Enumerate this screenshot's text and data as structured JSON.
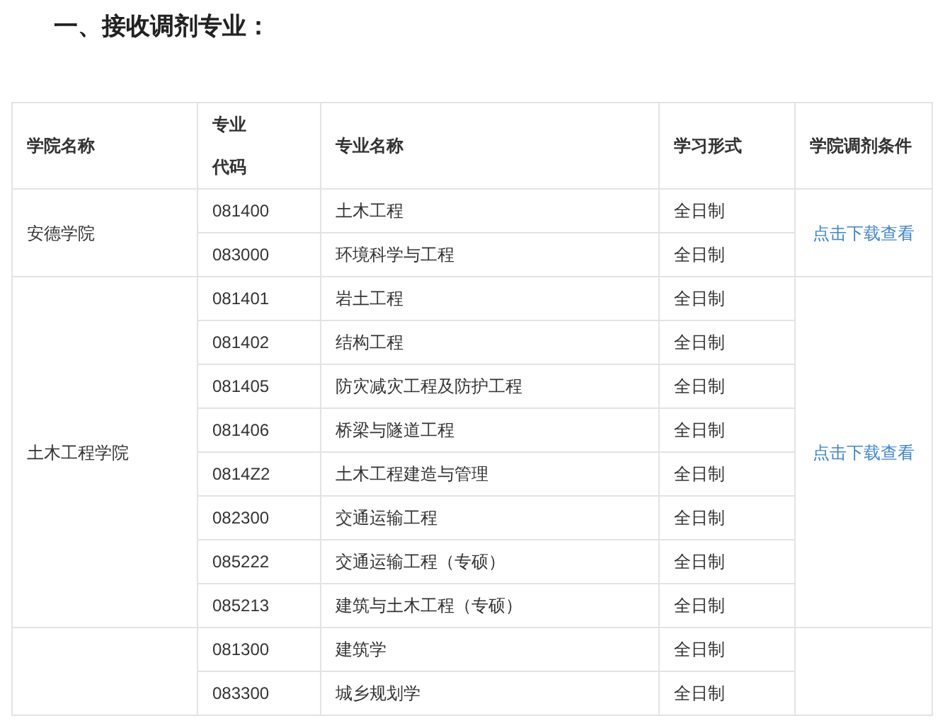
{
  "heading": "一、接收调剂专业：",
  "table": {
    "columns": [
      "学院名称",
      "专业代码",
      "专业名称",
      "学习形式",
      "学院调剂条件"
    ],
    "groups": [
      {
        "college": "安德学院",
        "link": "点击下载查看",
        "rows": [
          {
            "code": "081400",
            "name": "土木工程",
            "mode": "全日制"
          },
          {
            "code": "083000",
            "name": "环境科学与工程",
            "mode": "全日制"
          }
        ]
      },
      {
        "college": "土木工程学院",
        "link": "点击下载查看",
        "rows": [
          {
            "code": "081401",
            "name": "岩土工程",
            "mode": "全日制"
          },
          {
            "code": "081402",
            "name": "结构工程",
            "mode": "全日制"
          },
          {
            "code": "081405",
            "name": "防灾减灾工程及防护工程",
            "mode": "全日制"
          },
          {
            "code": "081406",
            "name": "桥梁与隧道工程",
            "mode": "全日制"
          },
          {
            "code": "0814Z2",
            "name": "土木工程建造与管理",
            "mode": "全日制"
          },
          {
            "code": "082300",
            "name": "交通运输工程",
            "mode": "全日制"
          },
          {
            "code": "085222",
            "name": "交通运输工程（专硕）",
            "mode": "全日制"
          },
          {
            "code": "085213",
            "name": "建筑与土木工程（专硕）",
            "mode": "全日制"
          }
        ]
      },
      {
        "rows": [
          {
            "code": "081300",
            "name": "建筑学",
            "mode": "全日制"
          },
          {
            "code": "083300",
            "name": "城乡规划学",
            "mode": "全日制"
          }
        ]
      }
    ]
  }
}
